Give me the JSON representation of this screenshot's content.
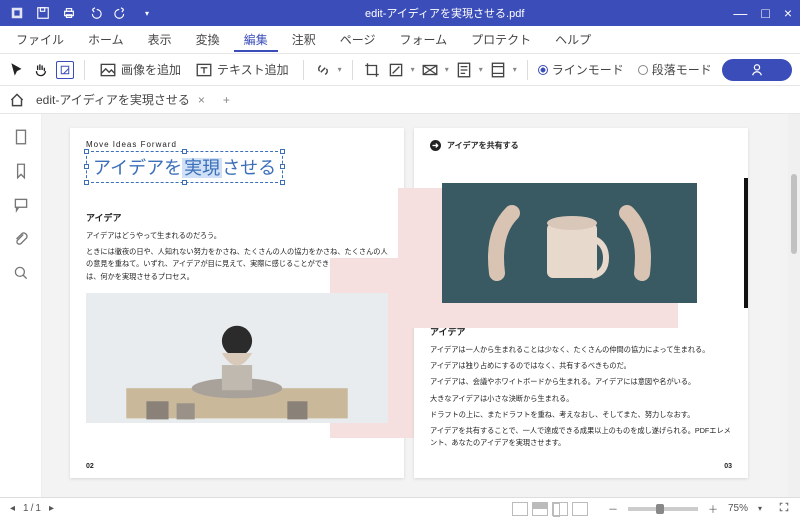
{
  "titlebar": {
    "filename": "edit-アイディアを実現させる.pdf"
  },
  "menu": {
    "file": "ファイル",
    "home": "ホーム",
    "display": "表示",
    "convert": "変換",
    "edit": "編集",
    "annotate": "注釈",
    "page": "ページ",
    "form": "フォーム",
    "protect": "プロテクト",
    "help": "ヘルプ"
  },
  "toolbar": {
    "add_image": "画像を追加",
    "add_text": "テキスト追加",
    "line_mode": "ラインモード",
    "paragraph_mode": "段落モード"
  },
  "tab": {
    "name": "edit-アイディアを実現させる",
    "close": "×",
    "add": "+"
  },
  "doc": {
    "left": {
      "kicker": "Move Ideas Forward",
      "headline_a": "アイデアを",
      "headline_sel": "実現",
      "headline_b": "させる",
      "sec_title": "アイデア",
      "p1": "アイデアはどうやって生まれるのだろう。",
      "p2": "ときには徹夜の日や、人知れない努力をかさね、たくさんの人の協力をかさね、たくさんの人の意見を重ねて。いずれ、アイデアが目に見えて、実際に感じることができる。アイデアとは、何かを実現させるプロセス。",
      "pgnum": "02"
    },
    "right": {
      "top_label": "アイデアを共有する",
      "sec_title": "アイデア",
      "p1": "アイデアは一人から生まれることは少なく、たくさんの仲間の協力によって生まれる。",
      "p2": "アイデアは独り占めにするのではなく、共有するべきものだ。",
      "p3": "アイデアは、会議やホワイトボードから生まれる。アイデアには意図や名がいる。",
      "p4": "大きなアイデアは小さな決断から生まれる。",
      "p5": "ドラフトの上に、またドラフトを重ね、考えなおし、そしてまた、努力しなおす。",
      "p6": "アイデアを共有することで、一人で達成できる成果以上のものを成し遂げられる。PDFエレメント、あなたのアイデアを実現させます。",
      "pgnum": "03"
    }
  },
  "status": {
    "page_current": "1",
    "page_sep": "/",
    "page_total": "1",
    "zoom_minus": "－",
    "zoom_plus": "＋",
    "zoom_pct": "75%"
  }
}
